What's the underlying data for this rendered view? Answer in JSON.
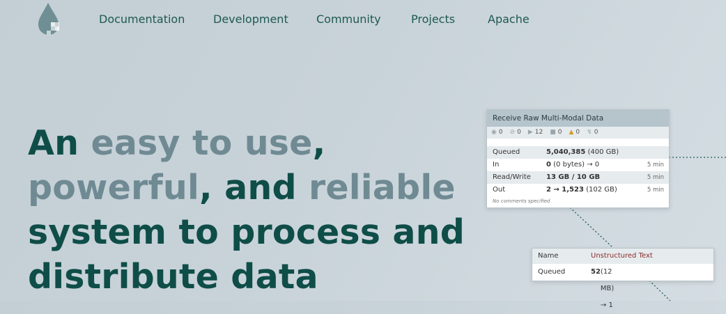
{
  "nav": {
    "items": [
      {
        "label": "Documentation"
      },
      {
        "label": "Development"
      },
      {
        "label": "Community"
      },
      {
        "label": "Projects"
      },
      {
        "label": "Apache"
      }
    ]
  },
  "hero": {
    "l1a": "An",
    "l1b": "easy to use",
    "l1c": ",",
    "l2a": "powerful",
    "l2b": ", and ",
    "l2c": "reliable",
    "l3": "system to process and",
    "l4": "distribute data"
  },
  "card1": {
    "title": "Receive Raw Multi-Modal Data",
    "stats": [
      "0",
      "0",
      "12",
      "0",
      "0",
      "0"
    ],
    "rows": [
      {
        "label": "Queued",
        "value_bold": "5,040,385",
        "value_rest": " (400 GB)",
        "time": ""
      },
      {
        "label": "In",
        "value_bold": "0",
        "value_rest": " (0 bytes) → 0",
        "time": "5 min"
      },
      {
        "label": "Read/Write",
        "value_bold": "13 GB / 10 GB",
        "value_rest": "",
        "time": "5 min"
      },
      {
        "label": "Out",
        "value_bold": "2 → 1,523",
        "value_rest": " (102 GB)",
        "time": "5 min"
      }
    ],
    "comment": "No comments specified"
  },
  "card2": {
    "name_label": "Name",
    "name_value": "Unstructured Text",
    "queued_label": "Queued",
    "queued_bold": "52",
    "queued_rest": " (12 MB) → 1"
  },
  "colors": {
    "dark": "#0f4d48",
    "muted": "#6f8a93",
    "nav": "#1e5852",
    "name_value": "#8a2a2a"
  }
}
